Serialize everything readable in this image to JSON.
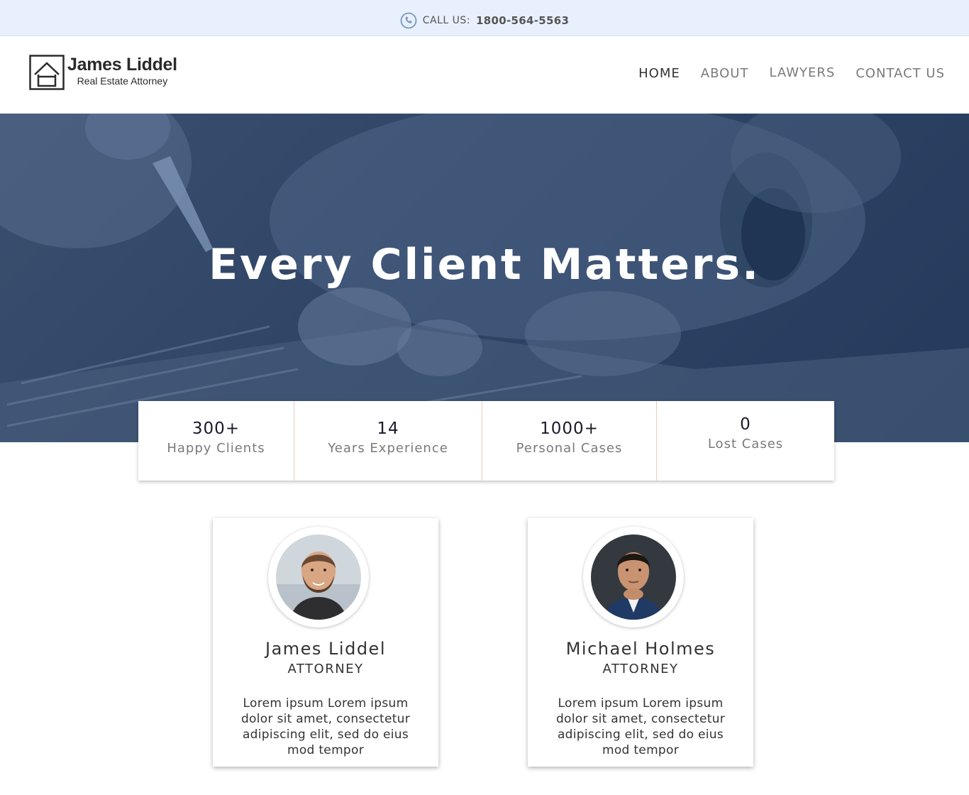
{
  "topbar": {
    "call_label": "CALL US:",
    "phone_number": "1800-564-5563",
    "icon": "phone-icon",
    "background": "#e8f0fd"
  },
  "logo": {
    "name": "James Liddel",
    "tagline": "Real Estate Attorney",
    "icon": "house-logo-icon"
  },
  "nav": {
    "items": [
      {
        "label": "HOME",
        "active": true
      },
      {
        "label": "ABOUT",
        "active": false
      },
      {
        "label": "LAWYERS",
        "active": false
      },
      {
        "label": "CONTACT US",
        "active": false
      }
    ]
  },
  "hero": {
    "title": "Every Client Matters.",
    "overlay_color": "#2f4566"
  },
  "stats": [
    {
      "value": "300+",
      "label": "Happy Clients"
    },
    {
      "value": "14",
      "label": "Years Experience"
    },
    {
      "value": "1000+",
      "label": "Personal Cases"
    },
    {
      "value": "0",
      "label": "Lost Cases"
    }
  ],
  "lawyers": [
    {
      "name": "James Liddel",
      "role": "ATTORNEY",
      "bio": "Lorem ipsum Lorem ipsum dolor sit amet, consectetur adipiscing elit, sed do eius mod tempor"
    },
    {
      "name": "Michael Holmes",
      "role": "ATTORNEY",
      "bio": "Lorem ipsum Lorem ipsum dolor sit amet, consectetur adipiscing elit, sed do eius mod tempor"
    }
  ]
}
